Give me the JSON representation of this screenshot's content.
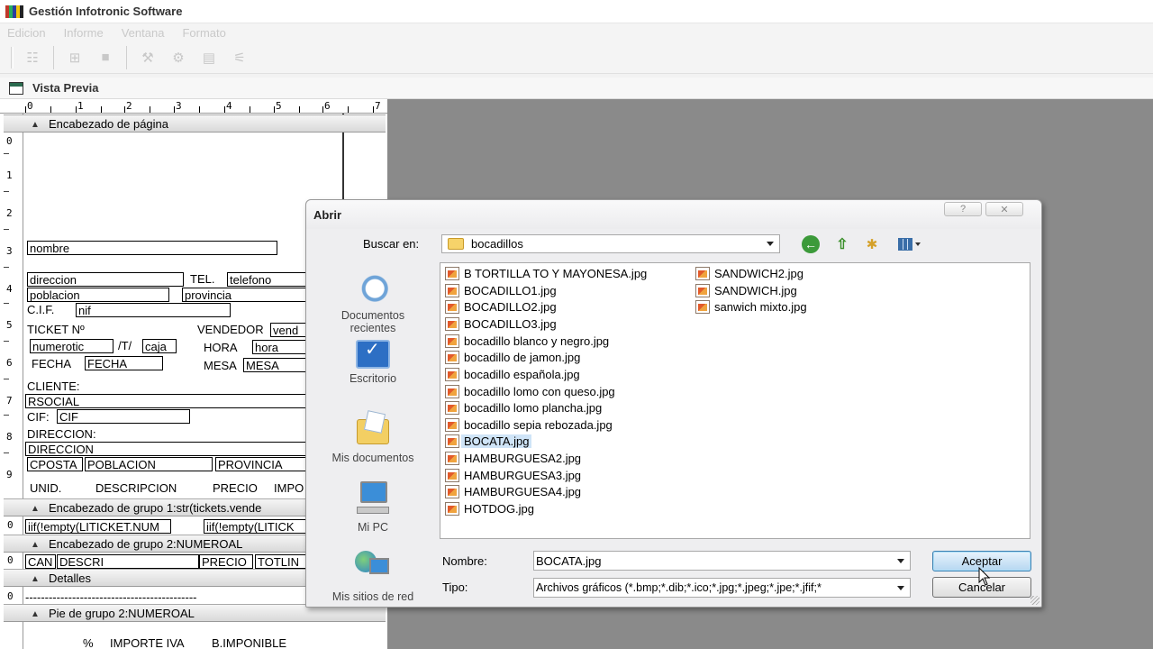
{
  "app": {
    "title": "Gestión Infotronic Software"
  },
  "menu": [
    "Edicion",
    "Informe",
    "Ventana",
    "Formato"
  ],
  "preview_window": {
    "title": "Vista Previa"
  },
  "designer": {
    "ruler_marks": [
      "0",
      "1",
      "2",
      "3",
      "4",
      "5",
      "6",
      "7"
    ],
    "vruler_marks": [
      "0",
      "1",
      "2",
      "3",
      "4",
      "5",
      "6",
      "7",
      "8",
      "9"
    ],
    "bands": {
      "page_header": "Encabezado de página",
      "group1": "Encabezado de grupo 1:str(tickets.vende",
      "group2": "Encabezado de grupo 2:NUMEROAL",
      "details": "Detalles",
      "group2_footer": "Pie de grupo 2:NUMEROAL"
    },
    "fields": {
      "nombre": "nombre",
      "direccion": "direccion",
      "tel_label": "TEL.",
      "telefono": "telefono",
      "poblacion": "poblacion",
      "provincia": "provincia",
      "cif_label": "C.I.F.",
      "nif": "nif",
      "ticket_label": "TICKET Nº",
      "vendedor_label": "VENDEDOR",
      "vend": "vend",
      "numerotic": "numerotic",
      "t_sep": "/T/",
      "caja": "caja",
      "hora_label": "HORA",
      "hora": "hora",
      "fecha_label": "FECHA",
      "fecha": "FECHA",
      "mesa_label": "MESA",
      "mesa": "MESA",
      "cliente_label": "CLIENTE:",
      "rsocial": "RSOCIAL",
      "cif2_label": "CIF:",
      "cif": "CIF",
      "direccion_label": "DIRECCION:",
      "direccion2": "DIRECCION",
      "cposta": "CPOSTA",
      "poblacion2": "POBLACION",
      "provincia2": "PROVINCIA",
      "col_unid": "UNID.",
      "col_descripcion": "DESCRIPCION",
      "col_precio": "PRECIO",
      "col_impo": "IMPO",
      "iif1": "iif(!empty(LITICKET.NUM",
      "iif2": "iif(!empty(LITICK",
      "can": "CAN",
      "descri": "DESCRI",
      "precio2": "PRECIO",
      "totlin": "TOTLIN",
      "dashes": "--------------------------------------------",
      "pct": "%",
      "importe_iva": "IMPORTE IVA",
      "b_imponible": "B.IMPONIBLE"
    }
  },
  "dialog": {
    "title": "Abrir",
    "help": "?",
    "close": "✕",
    "look_in_label": "Buscar en:",
    "look_in_value": "bocadillos",
    "places": [
      {
        "label": "Documentos recientes",
        "icon": "recent-documents-icon"
      },
      {
        "label": "Escritorio",
        "icon": "desktop-icon"
      },
      {
        "label": "Mis documentos",
        "icon": "my-documents-icon"
      },
      {
        "label": "Mi PC",
        "icon": "my-computer-icon"
      },
      {
        "label": "Mis sitios de red",
        "icon": "network-places-icon"
      }
    ],
    "files_col1": [
      "B TORTILLA TO Y MAYONESA.jpg",
      "BOCADILLO1.jpg",
      "BOCADILLO2.jpg",
      "BOCADILLO3.jpg",
      "bocadillo blanco y negro.jpg",
      "bocadillo de jamon.jpg",
      "bocadillo española.jpg",
      "bocadillo lomo con queso.jpg",
      "bocadillo lomo plancha.jpg",
      "bocadillo sepia rebozada.jpg",
      "BOCATA.jpg",
      "HAMBURGUESA2.jpg",
      "HAMBURGUESA3.jpg",
      "HAMBURGUESA4.jpg",
      "HOTDOG.jpg"
    ],
    "files_col2": [
      "SANDWICH2.jpg",
      "SANDWICH.jpg",
      "sanwich mixto.jpg"
    ],
    "selected_file": "BOCATA.jpg",
    "name_label": "Nombre:",
    "name_value": "BOCATA.jpg",
    "type_label": "Tipo:",
    "type_value": "Archivos gráficos (*.bmp;*.dib;*.ico;*.jpg;*.jpeg;*.jpe;*.jfif;*",
    "ok_label": "Aceptar",
    "cancel_label": "Cancelar"
  }
}
